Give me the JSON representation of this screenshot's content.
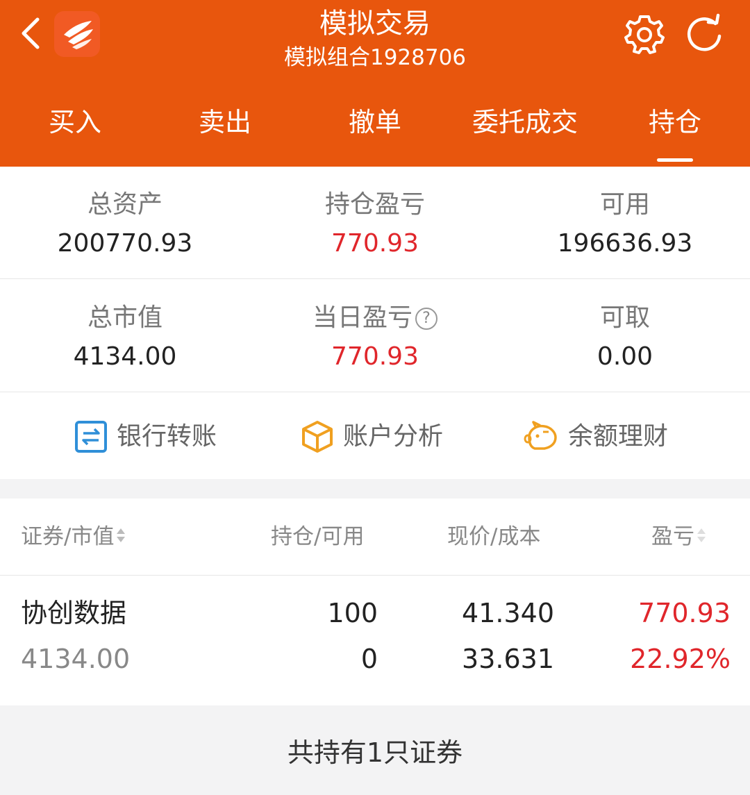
{
  "header": {
    "title": "模拟交易",
    "subtitle": "模拟组合1928706",
    "accent_color": "#e8560d",
    "icons": [
      "back-arrow-icon",
      "app-logo-icon",
      "gear-icon",
      "refresh-icon"
    ]
  },
  "tabs": [
    {
      "label": "买入"
    },
    {
      "label": "卖出"
    },
    {
      "label": "撤单"
    },
    {
      "label": "委托成交"
    },
    {
      "label": "持仓",
      "active": true
    }
  ],
  "summary": {
    "total_assets": {
      "label": "总资产",
      "value": "200770.93"
    },
    "position_pnl": {
      "label": "持仓盈亏",
      "value": "770.93"
    },
    "available": {
      "label": "可用",
      "value": "196636.93"
    },
    "market_value": {
      "label": "总市值",
      "value": "4134.00"
    },
    "daily_pnl": {
      "label": "当日盈亏",
      "value": "770.93",
      "help_icon": "question-circle-icon"
    },
    "withdrawable": {
      "label": "可取",
      "value": "0.00"
    }
  },
  "actions": [
    {
      "label": "银行转账",
      "icon": "bank-transfer-icon"
    },
    {
      "label": "账户分析",
      "icon": "cube-icon"
    },
    {
      "label": "余额理财",
      "icon": "piggy-bank-icon"
    }
  ],
  "holdings": {
    "columns": [
      "证券/市值",
      "持仓/可用",
      "现价/成本",
      "盈亏"
    ],
    "rows": [
      {
        "name": "协创数据",
        "market_value": "4134.00",
        "position": "100",
        "available": "0",
        "price": "41.340",
        "cost": "33.631",
        "pnl": "770.93",
        "pnl_pct": "22.92%"
      }
    ],
    "summary": "共持有1只证券"
  },
  "colors": {
    "profit_red": "#e0262b",
    "label_gray": "#777777"
  }
}
